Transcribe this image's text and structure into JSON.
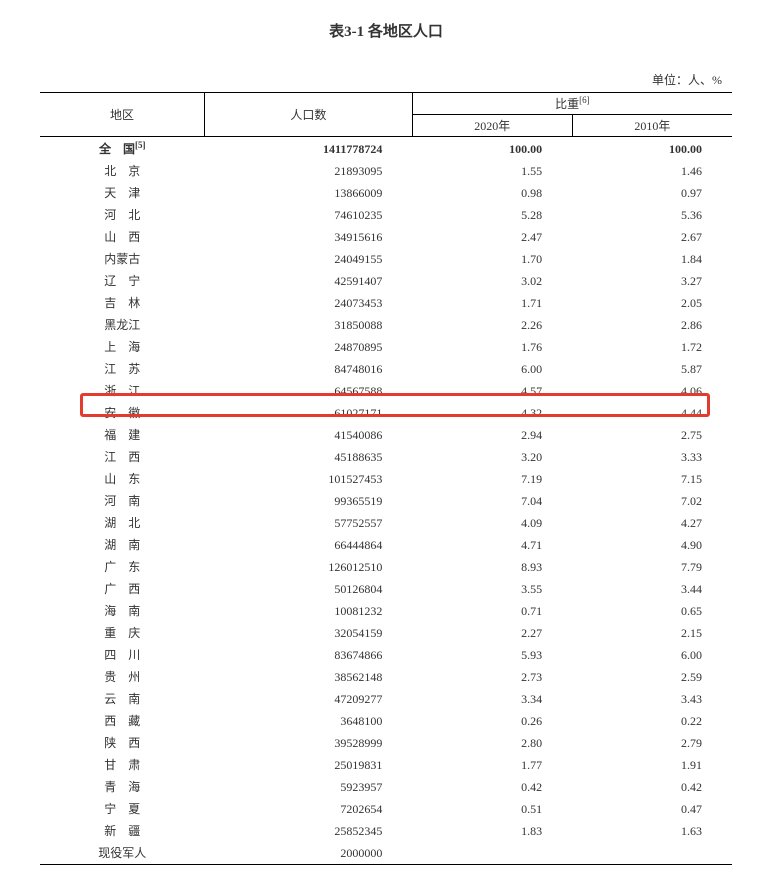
{
  "title": "表3-1 各地区人口",
  "unit_label": "单位：人、%",
  "headers": {
    "region": "地区",
    "population": "人口数",
    "ratio": "比重",
    "ratio_sup": "[6]",
    "y2020": "2020年",
    "y2010": "2010年"
  },
  "total_row": {
    "region": "全　国",
    "sup": "[5]",
    "population": "1411778724",
    "r2020": "100.00",
    "r2010": "100.00"
  },
  "highlight_region": "浙　江",
  "rows": [
    {
      "region": "北　京",
      "population": "21893095",
      "r2020": "1.55",
      "r2010": "1.46"
    },
    {
      "region": "天　津",
      "population": "13866009",
      "r2020": "0.98",
      "r2010": "0.97"
    },
    {
      "region": "河　北",
      "population": "74610235",
      "r2020": "5.28",
      "r2010": "5.36"
    },
    {
      "region": "山　西",
      "population": "34915616",
      "r2020": "2.47",
      "r2010": "2.67"
    },
    {
      "region": "内蒙古",
      "population": "24049155",
      "r2020": "1.70",
      "r2010": "1.84"
    },
    {
      "region": "辽　宁",
      "population": "42591407",
      "r2020": "3.02",
      "r2010": "3.27"
    },
    {
      "region": "吉　林",
      "population": "24073453",
      "r2020": "1.71",
      "r2010": "2.05"
    },
    {
      "region": "黑龙江",
      "population": "31850088",
      "r2020": "2.26",
      "r2010": "2.86"
    },
    {
      "region": "上　海",
      "population": "24870895",
      "r2020": "1.76",
      "r2010": "1.72"
    },
    {
      "region": "江　苏",
      "population": "84748016",
      "r2020": "6.00",
      "r2010": "5.87"
    },
    {
      "region": "浙　江",
      "population": "64567588",
      "r2020": "4.57",
      "r2010": "4.06"
    },
    {
      "region": "安　徽",
      "population": "61027171",
      "r2020": "4.32",
      "r2010": "4.44"
    },
    {
      "region": "福　建",
      "population": "41540086",
      "r2020": "2.94",
      "r2010": "2.75"
    },
    {
      "region": "江　西",
      "population": "45188635",
      "r2020": "3.20",
      "r2010": "3.33"
    },
    {
      "region": "山　东",
      "population": "101527453",
      "r2020": "7.19",
      "r2010": "7.15"
    },
    {
      "region": "河　南",
      "population": "99365519",
      "r2020": "7.04",
      "r2010": "7.02"
    },
    {
      "region": "湖　北",
      "population": "57752557",
      "r2020": "4.09",
      "r2010": "4.27"
    },
    {
      "region": "湖　南",
      "population": "66444864",
      "r2020": "4.71",
      "r2010": "4.90"
    },
    {
      "region": "广　东",
      "population": "126012510",
      "r2020": "8.93",
      "r2010": "7.79"
    },
    {
      "region": "广　西",
      "population": "50126804",
      "r2020": "3.55",
      "r2010": "3.44"
    },
    {
      "region": "海　南",
      "population": "10081232",
      "r2020": "0.71",
      "r2010": "0.65"
    },
    {
      "region": "重　庆",
      "population": "32054159",
      "r2020": "2.27",
      "r2010": "2.15"
    },
    {
      "region": "四　川",
      "population": "83674866",
      "r2020": "5.93",
      "r2010": "6.00"
    },
    {
      "region": "贵　州",
      "population": "38562148",
      "r2020": "2.73",
      "r2010": "2.59"
    },
    {
      "region": "云　南",
      "population": "47209277",
      "r2020": "3.34",
      "r2010": "3.43"
    },
    {
      "region": "西　藏",
      "population": "3648100",
      "r2020": "0.26",
      "r2010": "0.22"
    },
    {
      "region": "陕　西",
      "population": "39528999",
      "r2020": "2.80",
      "r2010": "2.79"
    },
    {
      "region": "甘　肃",
      "population": "25019831",
      "r2020": "1.77",
      "r2010": "1.91"
    },
    {
      "region": "青　海",
      "population": "5923957",
      "r2020": "0.42",
      "r2010": "0.42"
    },
    {
      "region": "宁　夏",
      "population": "7202654",
      "r2020": "0.51",
      "r2010": "0.47"
    },
    {
      "region": "新　疆",
      "population": "25852345",
      "r2020": "1.83",
      "r2010": "1.63"
    },
    {
      "region": "现役军人",
      "population": "2000000",
      "r2020": "",
      "r2010": ""
    }
  ]
}
